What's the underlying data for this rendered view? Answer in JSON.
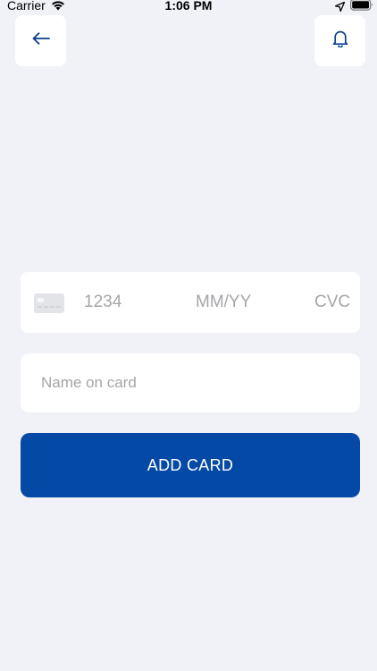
{
  "status_bar": {
    "carrier": "Carrier",
    "time": "1:06 PM"
  },
  "header": {
    "back_icon": "arrow-left-icon",
    "notification_icon": "bell-icon"
  },
  "card_form": {
    "card_icon": "credit-card-icon",
    "card_number_placeholder": "1234",
    "expiry_placeholder": "MM/YY",
    "cvc_placeholder": "CVC",
    "name_placeholder": "Name on card",
    "submit_label": "ADD CARD"
  },
  "colors": {
    "background": "#f1f2f7",
    "accent": "#0549a6",
    "icon": "#0b3f91",
    "placeholder": "#a6a6aa"
  }
}
